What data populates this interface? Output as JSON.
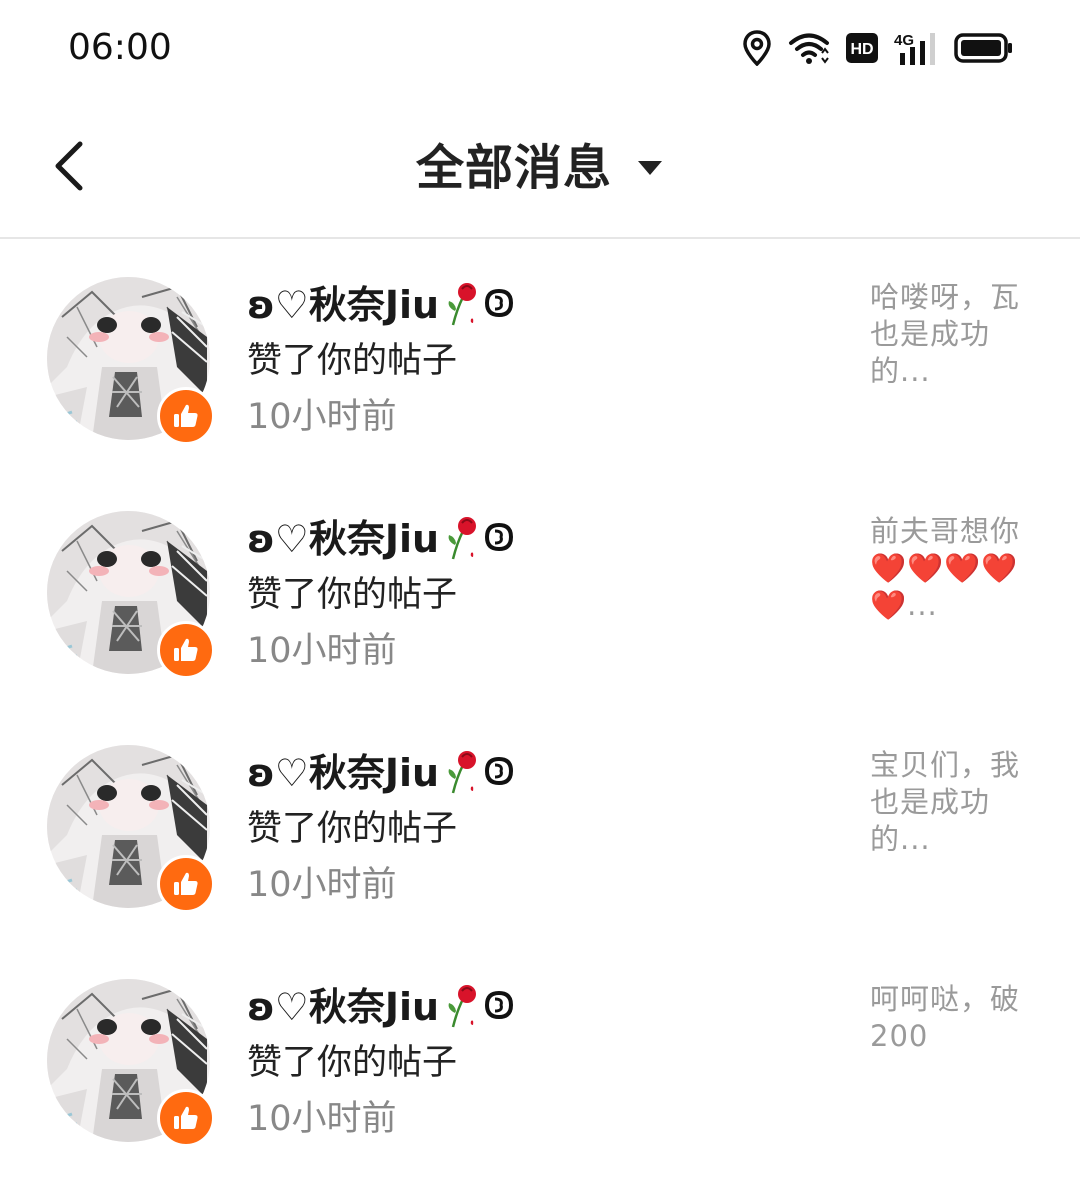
{
  "status_bar": {
    "time": "06:00",
    "icons": [
      "location-icon",
      "wifi-icon",
      "hd-icon",
      "signal-4g-icon",
      "battery-icon"
    ],
    "network": "4G",
    "hd_label": "HD"
  },
  "header": {
    "title": "全部消息",
    "back_icon": "chevron-left-icon",
    "dropdown_icon": "triangle-down-icon"
  },
  "colors": {
    "like_badge": "#ff6a10",
    "secondary_text": "#888888",
    "divider": "#e6e6e6"
  },
  "messages": [
    {
      "user_name": "ʚ♡秋奈Jiu",
      "action": "赞了你的帖子",
      "time": "10小时前",
      "preview": "哈喽呀，瓦也是成功的..."
    },
    {
      "user_name": "ʚ♡秋奈Jiu",
      "action": "赞了你的帖子",
      "time": "10小时前",
      "preview": "前夫哥想你❤️❤️❤️❤️❤️..."
    },
    {
      "user_name": "ʚ♡秋奈Jiu",
      "action": "赞了你的帖子",
      "time": "10小时前",
      "preview": "宝贝们，我也是成功的..."
    },
    {
      "user_name": "ʚ♡秋奈Jiu",
      "action": "赞了你的帖子",
      "time": "10小时前",
      "preview": "呵呵哒，破200"
    }
  ]
}
